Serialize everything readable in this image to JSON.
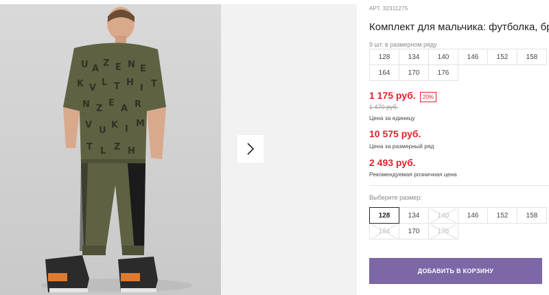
{
  "product": {
    "article": "АРТ. 32311275",
    "title": "Комплект для мальчика: футболка, брюки",
    "pack_label": "9 шт. в размерном ряду",
    "pack_sizes": [
      "128",
      "134",
      "140",
      "146",
      "152",
      "158",
      "164",
      "170",
      "176"
    ]
  },
  "pricing": {
    "unit_price": "1 175 руб.",
    "discount": "20%",
    "old_price": "1 470 руб.",
    "unit_caption": "Цена за единицу",
    "row_price": "10 575 руб.",
    "row_caption": "Цена за размерный ряд",
    "retail_price": "2 493 руб.",
    "retail_caption": "Рекомендуемая розничная цена"
  },
  "size_select": {
    "label": "Выберите размер:",
    "sizes": [
      {
        "label": "128",
        "state": "selected"
      },
      {
        "label": "134",
        "state": "available"
      },
      {
        "label": "140",
        "state": "disabled"
      },
      {
        "label": "146",
        "state": "available"
      },
      {
        "label": "152",
        "state": "available"
      },
      {
        "label": "158",
        "state": "available"
      },
      {
        "label": "164",
        "state": "disabled"
      },
      {
        "label": "170",
        "state": "available"
      },
      {
        "label": "176",
        "state": "disabled"
      }
    ]
  },
  "cart_button": "ДОБАВИТЬ В КОРЗИНУ",
  "colors": {
    "price_red": "#e21f2c",
    "button_purple": "#7c68a6",
    "khaki": "#5f6242"
  },
  "icons": {
    "gallery_next": "chevron-right-icon"
  }
}
